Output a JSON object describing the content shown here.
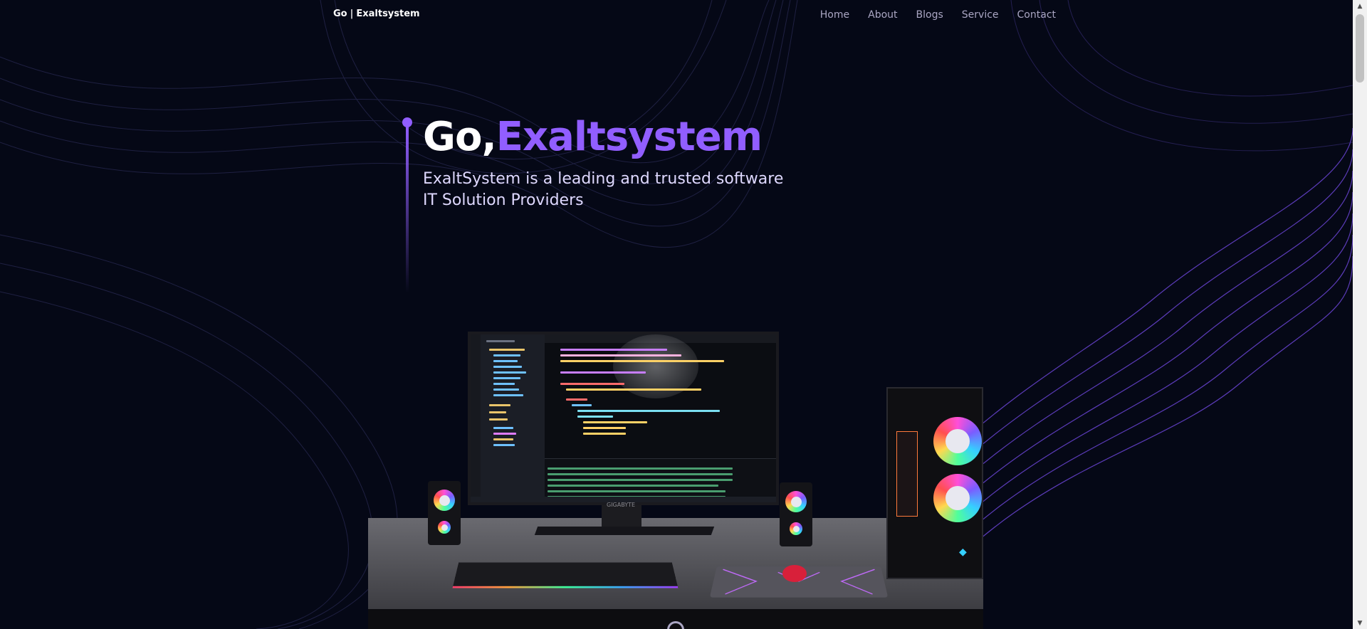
{
  "nav": {
    "logo_left": "Go",
    "logo_sep": "|",
    "logo_right": "Exaltsystem",
    "links": [
      "Home",
      "About",
      "Blogs",
      "Service",
      "Contact"
    ]
  },
  "hero": {
    "title_prefix": "Go,",
    "title_highlight": "Exaltsystem",
    "subtitle_line1": "ExaltSystem is a leading and trusted software",
    "subtitle_line2": "IT Solution Providers"
  },
  "scene": {
    "monitor_brand": "GIGABYTE"
  },
  "colors": {
    "background": "#050816",
    "accent": "#915eff",
    "nav_text": "#aaa6c3"
  }
}
